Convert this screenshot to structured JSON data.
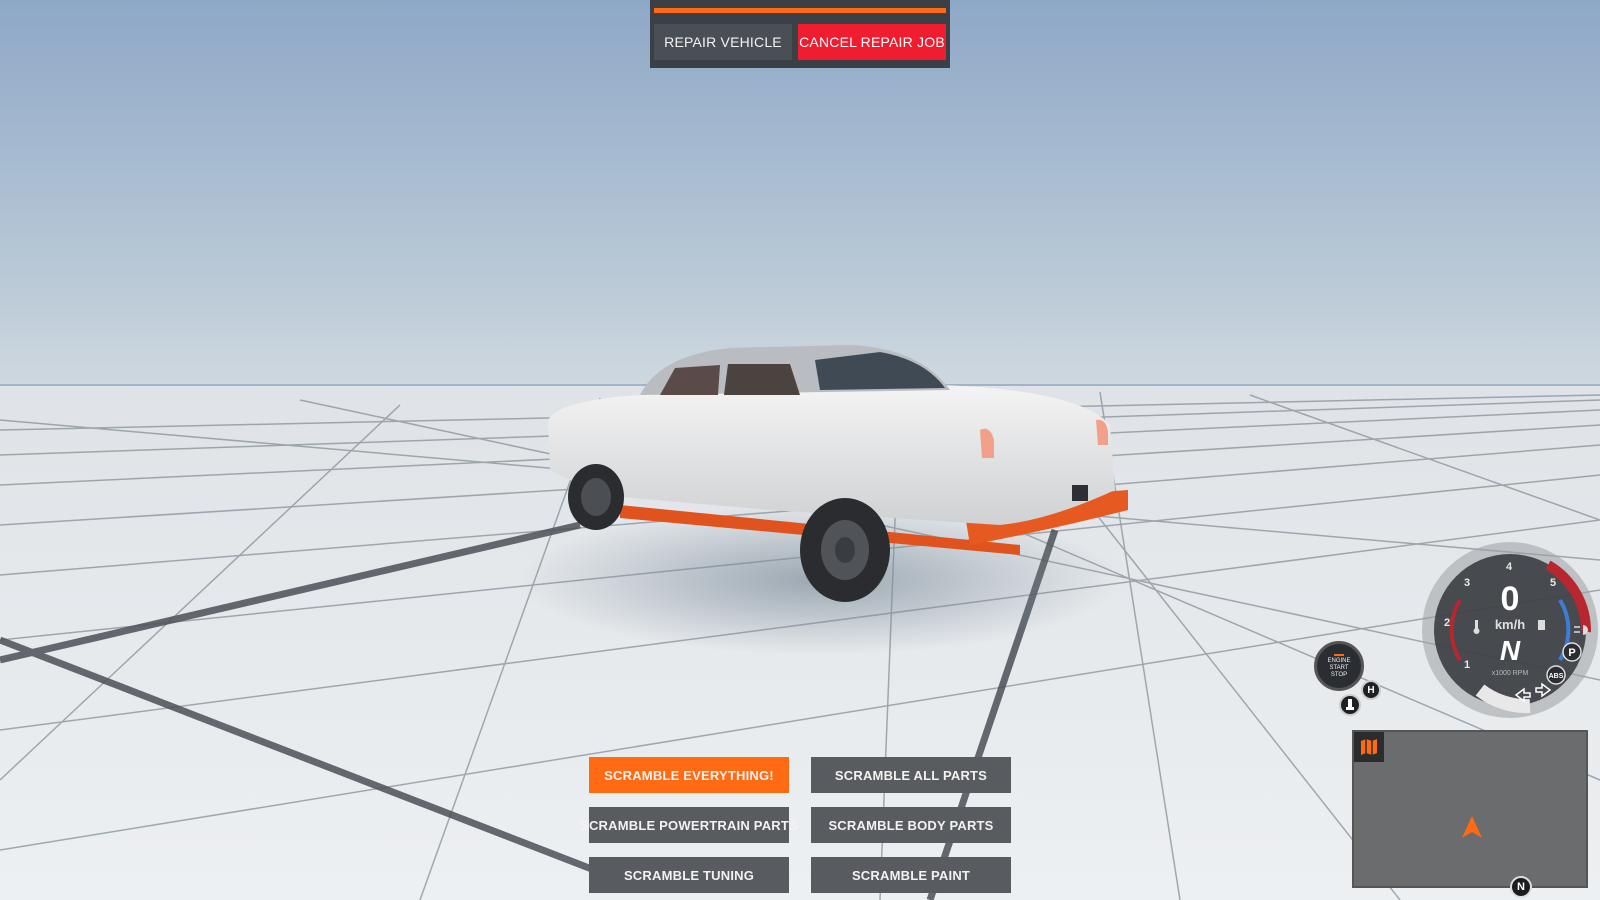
{
  "repair": {
    "repair_label": "REPAIR VEHICLE",
    "cancel_label": "CANCEL REPAIR JOB",
    "progress": 1.0
  },
  "scramble": {
    "everything": "SCRAMBLE EVERYTHING!",
    "all_parts": "SCRAMBLE ALL PARTS",
    "powertrain": "SCRAMBLE POWERTRAIN PARTS",
    "body": "SCRAMBLE BODY PARTS",
    "tuning": "SCRAMBLE TUNING",
    "paint": "SCRAMBLE PAINT"
  },
  "dashboard": {
    "speed": "0",
    "speed_unit": "km/h",
    "gear": "N",
    "rpm_label": "x1000 RPM",
    "rpm_ticks": [
      "1",
      "2",
      "3",
      "4",
      "5"
    ],
    "engine_button": [
      "ENGINE",
      "START",
      "STOP"
    ],
    "park_label": "P",
    "abs_label": "ABS",
    "handbrake_label": "H"
  },
  "minimap": {
    "compass_label": "N"
  },
  "colors": {
    "accent": "#ff6a13",
    "cancel": "#ef1d2f",
    "button": "#585b60",
    "sky_top": "#92acc9",
    "floor": "#e6e9ec"
  },
  "icons": {
    "map": "map-icon",
    "pedal": "pedal-icon",
    "handbrake": "handbrake-icon",
    "fuel": "fuel-icon",
    "temperature": "temperature-icon",
    "lights": "headlight-icon",
    "turn_left": "turn-left-icon",
    "turn_right": "turn-right-icon",
    "player_marker": "player-arrow-icon"
  }
}
